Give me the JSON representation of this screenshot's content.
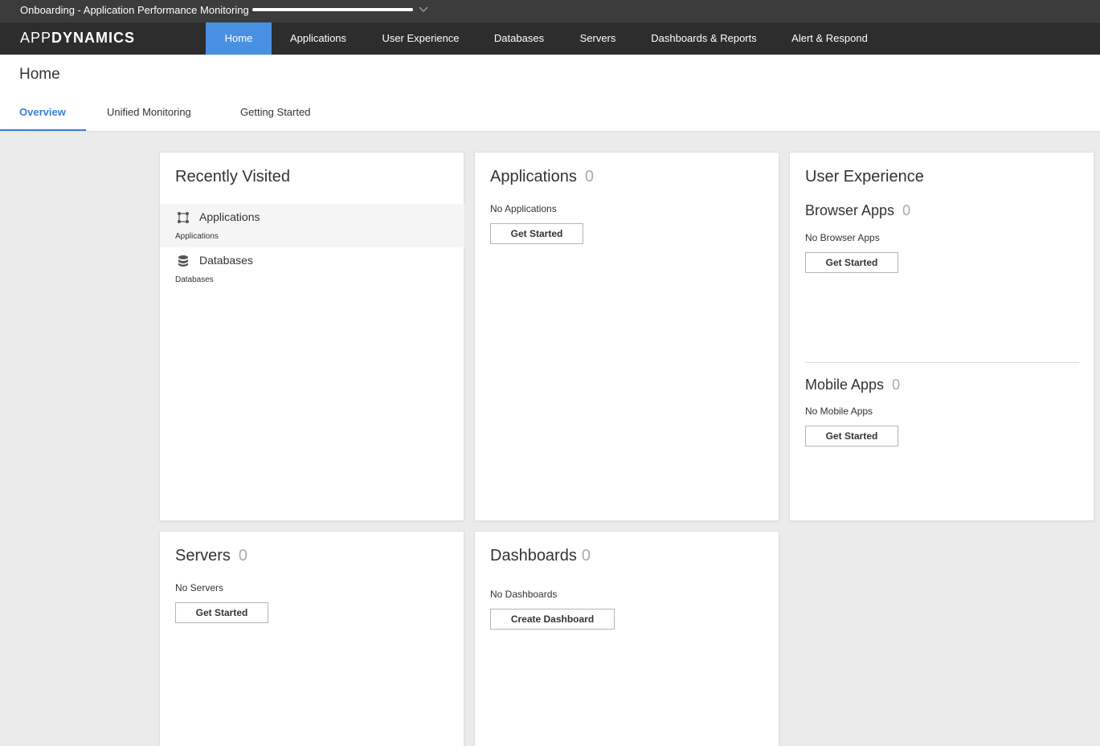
{
  "onboarding": {
    "title": "Onboarding - Application Performance Monitoring",
    "progress_fraction": 1.0
  },
  "nav": {
    "logo_thin": "APP",
    "logo_bold": "DYNAMICS",
    "items": [
      {
        "label": "Home",
        "active": true
      },
      {
        "label": "Applications"
      },
      {
        "label": "User Experience"
      },
      {
        "label": "Databases"
      },
      {
        "label": "Servers"
      },
      {
        "label": "Dashboards & Reports"
      },
      {
        "label": "Alert & Respond"
      }
    ]
  },
  "page": {
    "title": "Home",
    "tabs": [
      {
        "label": "Overview",
        "active": true
      },
      {
        "label": "Unified Monitoring"
      },
      {
        "label": "Getting Started"
      }
    ]
  },
  "recently_visited": {
    "title": "Recently Visited",
    "items": [
      {
        "label": "Applications",
        "sub": "Applications",
        "icon": "application-flow-icon"
      },
      {
        "label": "Databases",
        "sub": "Databases",
        "icon": "database-icon"
      }
    ]
  },
  "applications": {
    "title": "Applications",
    "count": "0",
    "empty": "No Applications",
    "button": "Get Started"
  },
  "user_experience": {
    "title": "User Experience",
    "browser": {
      "title": "Browser Apps",
      "count": "0",
      "empty": "No Browser Apps",
      "button": "Get Started"
    },
    "mobile": {
      "title": "Mobile Apps",
      "count": "0",
      "empty": "No Mobile Apps",
      "button": "Get Started"
    }
  },
  "servers": {
    "title": "Servers",
    "count": "0",
    "empty": "No Servers",
    "button": "Get Started"
  },
  "dashboards": {
    "title": "Dashboards",
    "count": "0",
    "empty": "No Dashboards",
    "button": "Create Dashboard"
  },
  "colors": {
    "accent": "#4a90e2",
    "nav_bg": "#2d2d2d",
    "onboarding_bg": "#3c3c3c",
    "page_bg": "#ebebeb"
  }
}
